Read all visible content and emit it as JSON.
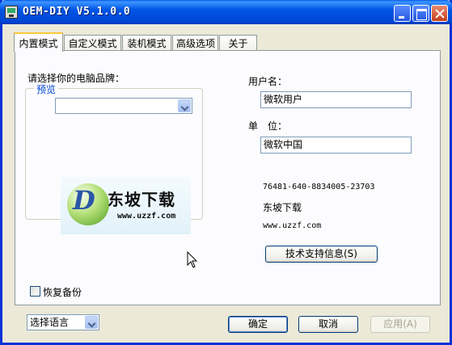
{
  "window": {
    "title": "OEM-DIY V5.1.0.0"
  },
  "tabs": [
    {
      "label": "内置模式",
      "active": true
    },
    {
      "label": "自定义模式",
      "active": false
    },
    {
      "label": "装机模式",
      "active": false
    },
    {
      "label": "高级选项",
      "active": false
    },
    {
      "label": "关于",
      "active": false
    }
  ],
  "brand": {
    "label": "请选择你的电脑品牌：",
    "selected": ""
  },
  "preview": {
    "title": "预览",
    "logo_text": "东坡下载",
    "logo_url": "www.uzzf.com",
    "logo_letter": "D"
  },
  "user": {
    "username_label": "用户名：",
    "username_value": "微软用户",
    "org_label": "单　位：",
    "org_value": "微软中国"
  },
  "support": {
    "phone": "76481-640-8834005-23703",
    "name": "东坡下载",
    "url": "www.uzzf.com",
    "button_label": "技术支持信息(S)"
  },
  "backup": {
    "label": "恢复备份",
    "checked": false
  },
  "footer": {
    "language": "选择语言",
    "ok_label": "确定",
    "cancel_label": "取消",
    "apply_label": "应用(A)"
  },
  "colors": {
    "titlebar": "#0055e5",
    "tab_highlight": "#ffc83c",
    "group_title": "#0046d5"
  }
}
